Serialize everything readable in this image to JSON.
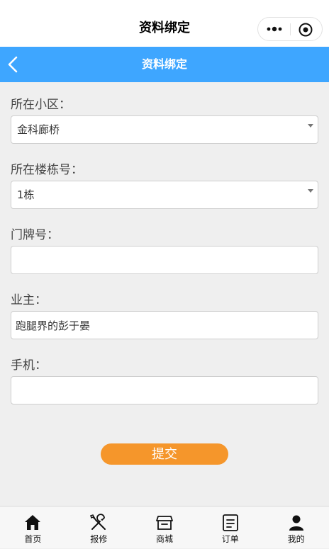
{
  "top_bar": {
    "title": "资料绑定",
    "icons": [
      "more-dots-icon",
      "target-icon"
    ]
  },
  "header": {
    "title": "资料绑定",
    "back_icon": "chevron-left-icon",
    "color": "#3ea6ff"
  },
  "form": {
    "community": {
      "label": "所在小区：",
      "value": "金科廊桥"
    },
    "building": {
      "label": "所在楼栋号：",
      "value": "1栋"
    },
    "door": {
      "label": "门牌号：",
      "value": ""
    },
    "owner": {
      "label": "业主：",
      "value": "跑腿界的彭于晏"
    },
    "phone": {
      "label": "手机：",
      "value": ""
    }
  },
  "submit": {
    "label": "提交",
    "color": "#f5962b"
  },
  "tabbar": {
    "items": [
      {
        "label": "首页",
        "icon": "home-icon"
      },
      {
        "label": "报修",
        "icon": "tools-icon"
      },
      {
        "label": "商城",
        "icon": "shop-icon"
      },
      {
        "label": "订单",
        "icon": "order-icon"
      },
      {
        "label": "我的",
        "icon": "user-icon"
      }
    ]
  }
}
